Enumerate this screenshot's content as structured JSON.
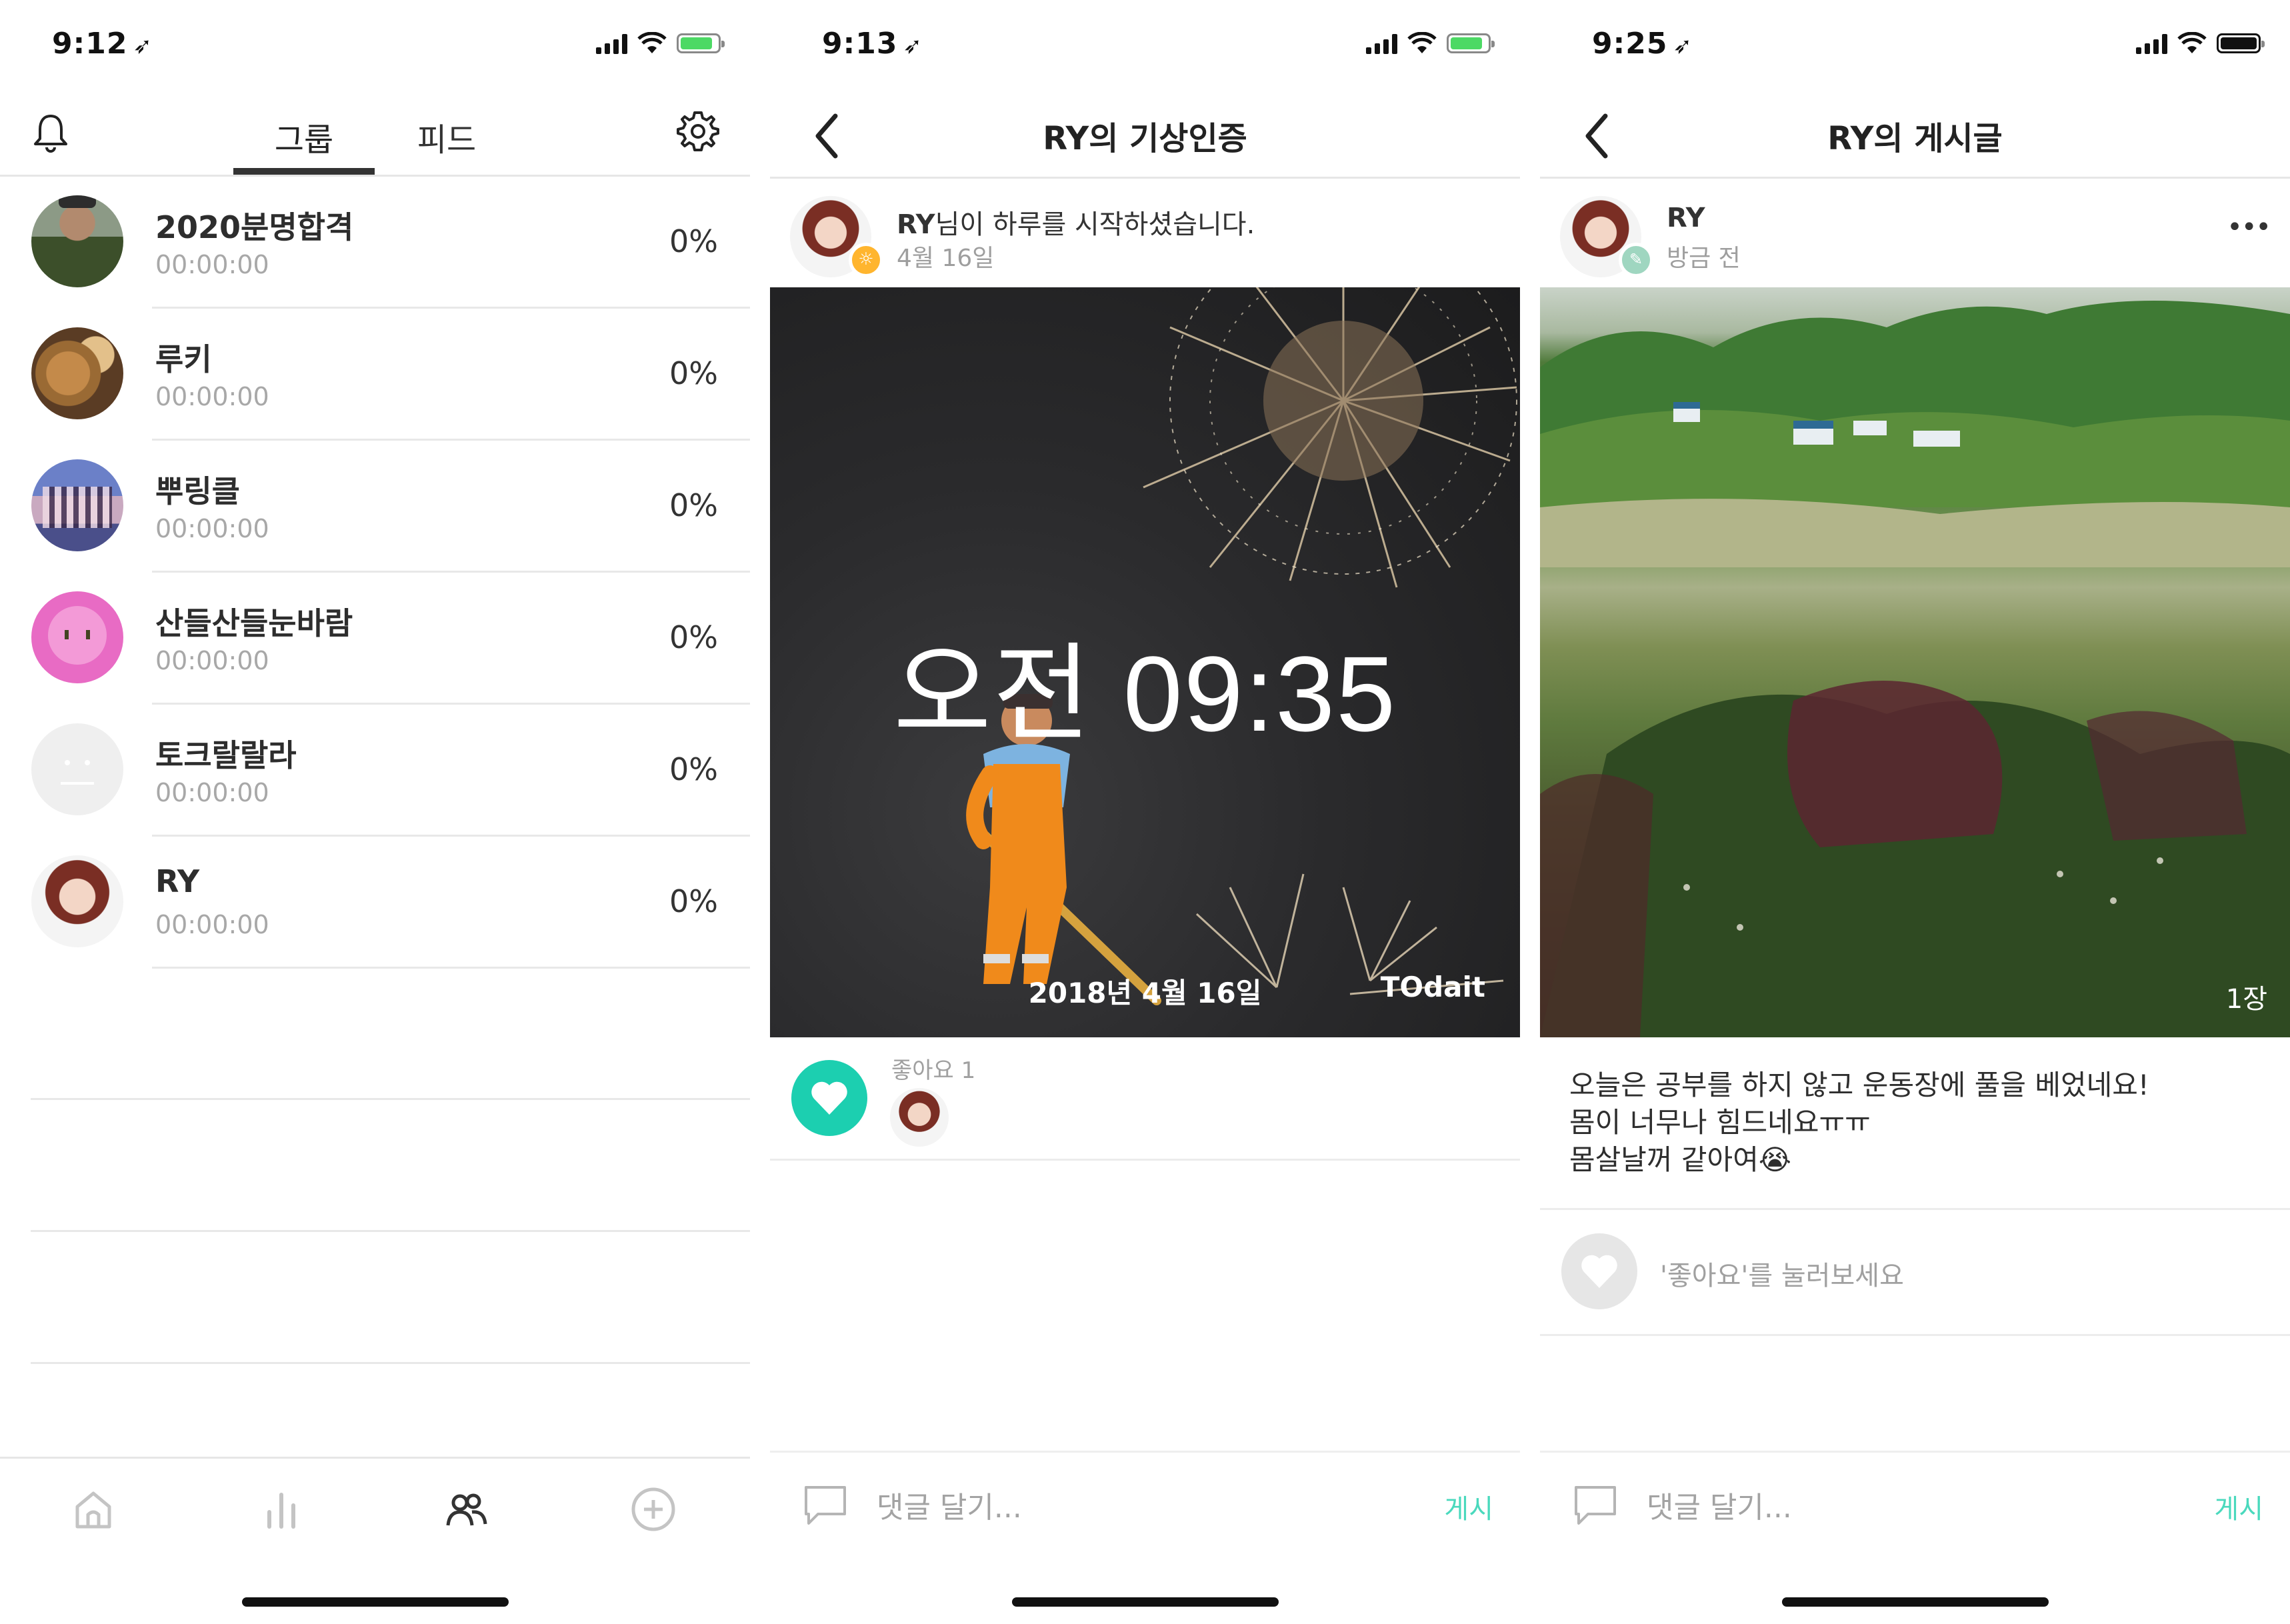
{
  "screen1": {
    "status": {
      "time": "9:12",
      "loc": "➶"
    },
    "tabs": [
      {
        "label": "그룹"
      },
      {
        "label": "피드"
      }
    ],
    "groups": [
      {
        "name": "2020분명합격",
        "time": "00:00:00",
        "percent": "0%",
        "avatar": "person-back"
      },
      {
        "name": "루키",
        "time": "00:00:00",
        "percent": "0%",
        "avatar": "bread"
      },
      {
        "name": "뿌링클",
        "time": "00:00:00",
        "percent": "0%",
        "avatar": "group-photo"
      },
      {
        "name": "산들산들눈바람",
        "time": "00:00:00",
        "percent": "0%",
        "avatar": "pink-character"
      },
      {
        "name": "토크랄랄라",
        "time": "00:00:00",
        "percent": "0%",
        "avatar": "default-face"
      },
      {
        "name": "RY",
        "time": "00:00:00",
        "percent": "0%",
        "avatar": "girl-photo"
      }
    ],
    "tabbar": [
      "home-icon",
      "stats-icon",
      "group-icon",
      "add-icon"
    ]
  },
  "screen2": {
    "status": {
      "time": "9:13",
      "loc": "➶"
    },
    "title": "RY의 기상인증",
    "post": {
      "author": "RY",
      "message_suffix": "님이 하루를 시작하셨습니다.",
      "date": "4월 16일",
      "photo_time": "오전 09:35",
      "photo_date": "2018년 4월 16일",
      "brand": "TOdait"
    },
    "likes": {
      "label": "좋아요 1"
    },
    "comment": {
      "placeholder": "댓글 달기...",
      "post_label": "게시"
    }
  },
  "screen3": {
    "status": {
      "time": "9:25",
      "loc": "➶"
    },
    "title": "RY의 게시글",
    "post": {
      "author": "RY",
      "time": "방금 전",
      "photo_count": "1장",
      "text_line1": "오늘은 공부를 하지 않고 운동장에 풀을 베었네요!",
      "text_line2": "몸이 너무나 힘드네요ㅠㅠ",
      "text_line3": "몸살날꺼 같아여😭"
    },
    "like_prompt": "'좋아요'를 눌러보세요",
    "comment": {
      "placeholder": "댓글 달기...",
      "post_label": "게시"
    }
  },
  "colors": {
    "accent": "#1ccfb0",
    "battery_charging": "#4cd964"
  }
}
